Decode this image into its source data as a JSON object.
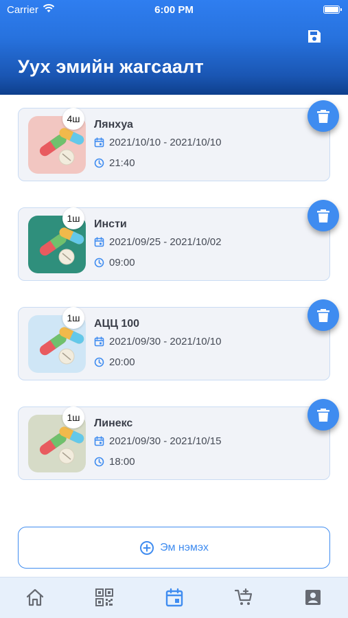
{
  "status_bar": {
    "carrier": "Carrier",
    "time": "6:00 PM"
  },
  "header": {
    "title": "Уух эмийн жагсаалт",
    "save_icon": "save-icon"
  },
  "medications": [
    {
      "name": "Лянхуа",
      "quantity": "4ш",
      "date_range": "2021/10/10 - 2021/10/10",
      "time": "21:40",
      "image_bg": "#f2c6c1"
    },
    {
      "name": "Инсти",
      "quantity": "1ш",
      "date_range": "2021/09/25 - 2021/10/02",
      "time": "09:00",
      "image_bg": "#2f8f7c"
    },
    {
      "name": "АЦЦ 100",
      "quantity": "1ш",
      "date_range": "2021/09/30 - 2021/10/10",
      "time": "20:00",
      "image_bg": "#cfe6f6"
    },
    {
      "name": "Линекс",
      "quantity": "1ш",
      "date_range": "2021/09/30 - 2021/10/15",
      "time": "18:00",
      "image_bg": "#d6dbc7"
    }
  ],
  "add_button": {
    "label": "Эм нэмэх"
  },
  "tabbar": {
    "items": [
      {
        "icon": "home-icon",
        "active": false
      },
      {
        "icon": "qr-code-icon",
        "active": false
      },
      {
        "icon": "calendar-icon",
        "active": true
      },
      {
        "icon": "cart-plus-icon",
        "active": false
      },
      {
        "icon": "contact-card-icon",
        "active": false
      }
    ]
  },
  "colors": {
    "accent": "#3f8cf0",
    "header_top": "#2f7ef0",
    "header_bottom": "#0e3f8c",
    "tab_inactive": "#666a72"
  }
}
